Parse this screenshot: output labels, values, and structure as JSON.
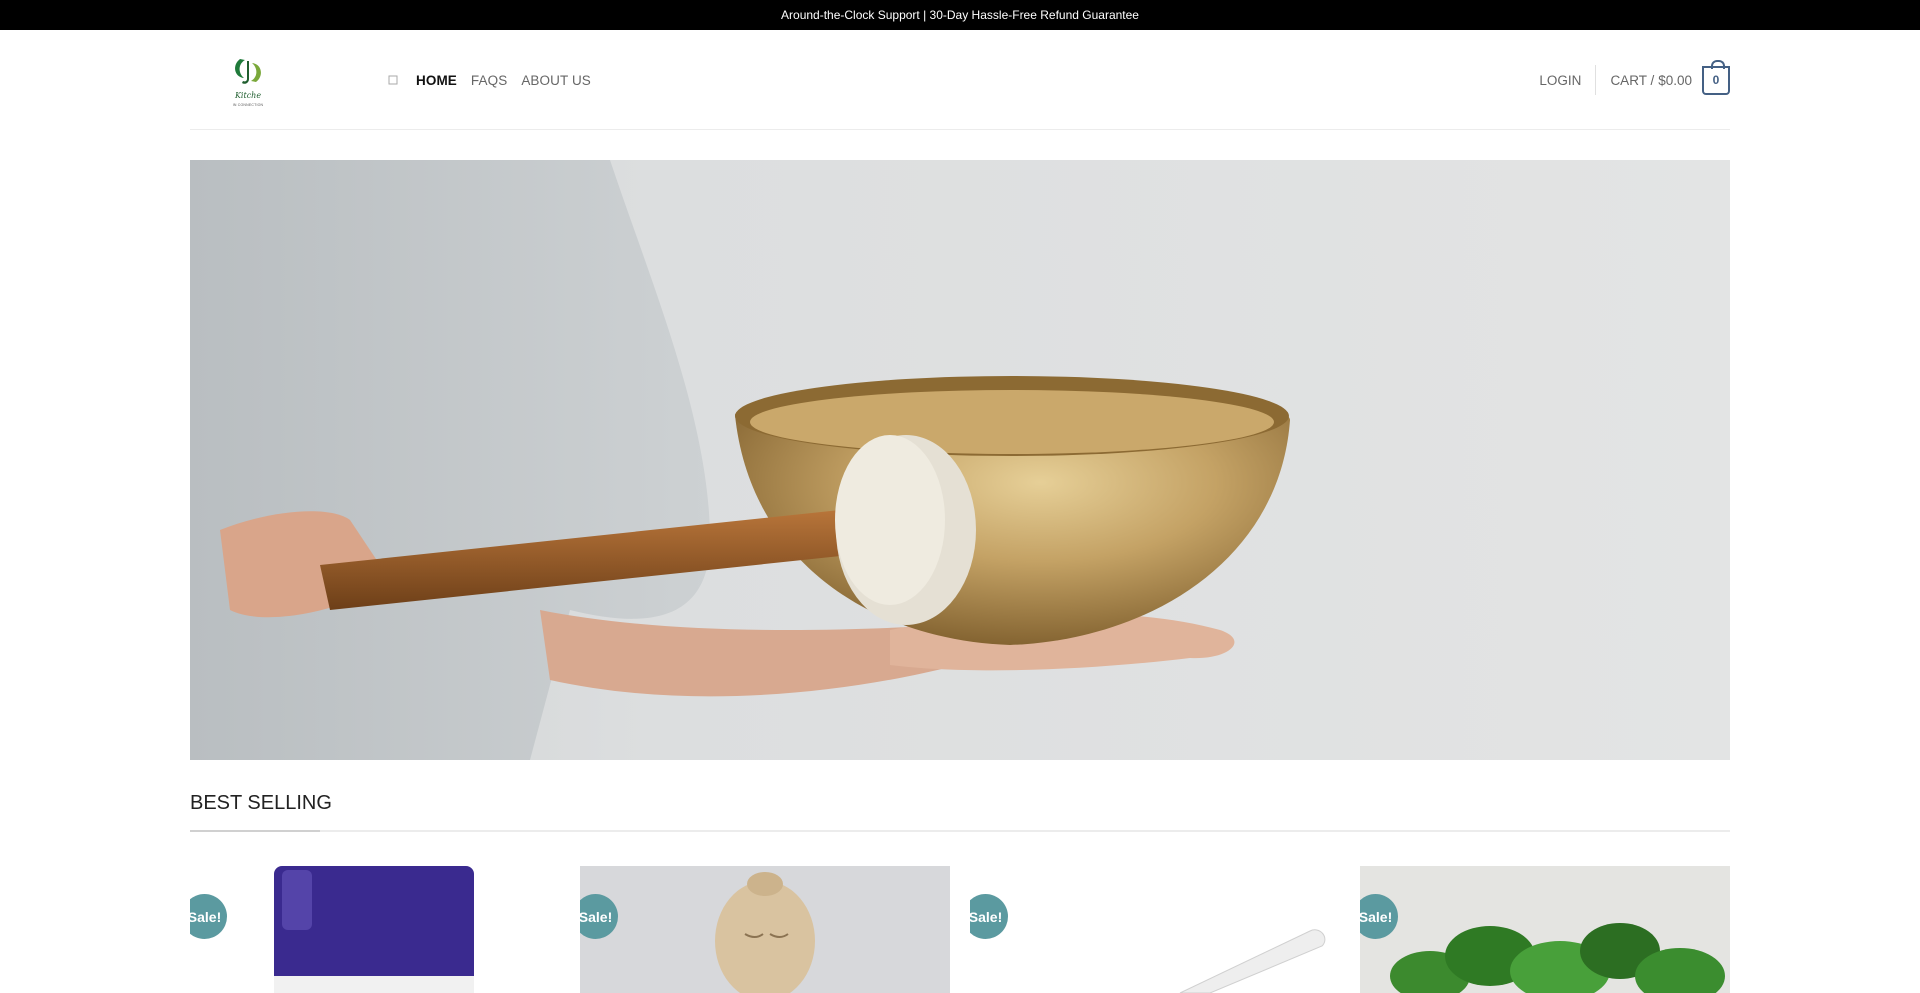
{
  "announcement": "Around-the-Clock Support | 30-Day Hassle-Free Refund Guarantee",
  "brand": {
    "logo_text": "Kitche",
    "logo_tagline": "IN CONNECTION"
  },
  "nav": {
    "items": [
      "HOME",
      "FAQS",
      "ABOUT US"
    ],
    "active": "HOME"
  },
  "account": {
    "login_label": "LOGIN",
    "cart_label": "CART /",
    "cart_amount": "$0.00",
    "cart_count": "0"
  },
  "hero": {
    "alt": ""
  },
  "section": {
    "title": "BEST SELLING"
  },
  "products": [
    {
      "badge": "Sale!"
    },
    {
      "badge": "Sale!"
    },
    {
      "badge": "Sale!"
    },
    {
      "badge": "Sale!"
    }
  ],
  "colors": {
    "topbar_bg": "#000000",
    "accent": "#446084",
    "sale_badge": "#5b9aa0",
    "logo_green": "#1f7a3a"
  }
}
